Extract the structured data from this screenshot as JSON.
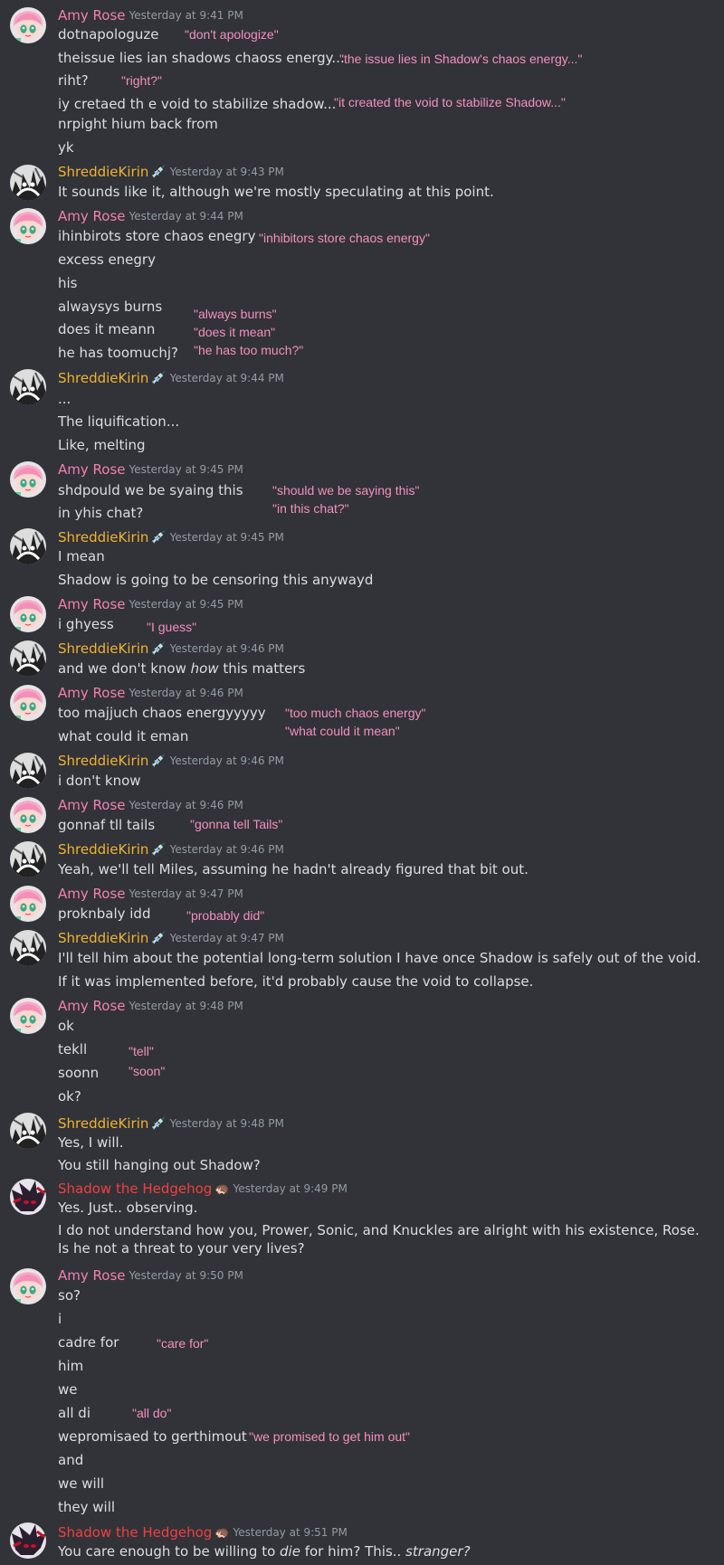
{
  "users": {
    "amy": "Amy Rose",
    "shreddie": "ShreddieKirin",
    "shadow": "Shadow the Hedgehog"
  },
  "timestamps": {
    "t941": "Yesterday at 9:41 PM",
    "t943": "Yesterday at 9:43 PM",
    "t944": "Yesterday at 9:44 PM",
    "t945": "Yesterday at 9:45 PM",
    "t946": "Yesterday at 9:46 PM",
    "t947": "Yesterday at 9:47 PM",
    "t948": "Yesterday at 9:48 PM",
    "t949": "Yesterday at 9:49 PM",
    "t950": "Yesterday at 9:50 PM",
    "t951": "Yesterday at 9:51 PM"
  },
  "lines": {
    "l1": "dotnapologuze",
    "l2": "theissue lies ian shadows chaoss energy...",
    "l3": "riht?",
    "l4": "iy cretaed th e void to stabilize shadow...",
    "l5": "nrpight hium back from",
    "l6": "yk",
    "l7": "It sounds like it, although we're mostly speculating at this point.",
    "l8": "ihinbirots store chaos enegry",
    "l9": "excess enegry",
    "l10": "his",
    "l11": "alwaysys burns",
    "l12": "does it meann",
    "l13": "he has toomuchj?",
    "l14": "...",
    "l15": "The liquification...",
    "l16": "Like, melting",
    "l17": "shdpould we be syaing this",
    "l18": "in yhis chat?",
    "l19": "I mean",
    "l20": "Shadow is going to be censoring this anywayd",
    "l21": "i ghyess",
    "l22a": "and we don't know ",
    "l22b": "how",
    "l22c": " this matters",
    "l23": "too majjuch chaos energyyyyy",
    "l24": "what could it eman",
    "l25": "i don't know",
    "l26": "gonnaf tll tails",
    "l27": "Yeah, we'll tell Miles, assuming he hadn't already figured that bit out.",
    "l28": "proknbaly idd",
    "l29": "I'll tell him about the potential long-term solution I have once Shadow is safely out of the void.",
    "l30": "If it was implemented before, it'd probably cause the void to collapse.",
    "l31": "ok",
    "l32": "tekll",
    "l33": "soonn",
    "l34": "ok?",
    "l35": "Yes, I will.",
    "l36": "You still hanging out Shadow?",
    "l37": "Yes. Just.. observing.",
    "l38": "I do not understand how you, Prower, Sonic, and Knuckles are alright with his existence, Rose. Is he not a threat to your very lives?",
    "l39": "so?",
    "l40": "i",
    "l41": "cadre for",
    "l42": "him",
    "l43": "we",
    "l44": "all di",
    "l45": "wepromisaed to gerthimout",
    "l46": "and",
    "l47": "we will",
    "l48": "they will",
    "l49a": "You care enough to be willing to ",
    "l49b": "die",
    "l49c": " for him? This.. ",
    "l49d": "stranger?"
  },
  "notes": {
    "n1": "\"don't apologize\"",
    "n2": "\"the issue lies in Shadow's chaos energy...\"",
    "n3": "\"right?\"",
    "n4": "\"it created the void to stabilize Shadow...\"",
    "n5": "\"inhibitors store chaos energy\"",
    "n6": "\"always burns\"",
    "n7": "\"does it mean\"",
    "n8": "\"he has too much?\"",
    "n9": "\"should we be saying this\"",
    "n10": "\"in this chat?\"",
    "n11": "\"I guess\"",
    "n12": "\"too much chaos energy\"",
    "n13": "\"what could it mean\"",
    "n14": "\"gonna tell Tails\"",
    "n15": "\"probably did\"",
    "n16": "\"tell\"",
    "n17": "\"soon\"",
    "n18": "\"care for\"",
    "n19": "\"all do\"",
    "n20": "\"we promised to get him out\""
  },
  "colors": {
    "background": "#313338",
    "amy_name": "#f47fb1",
    "shreddie_name": "#f0b232",
    "shadow_name": "#f23f42",
    "annotation": "#f58fbd"
  },
  "icons": {
    "shreddie_badge": "syringe-icon",
    "shadow_badge": "shadow-head-icon"
  }
}
